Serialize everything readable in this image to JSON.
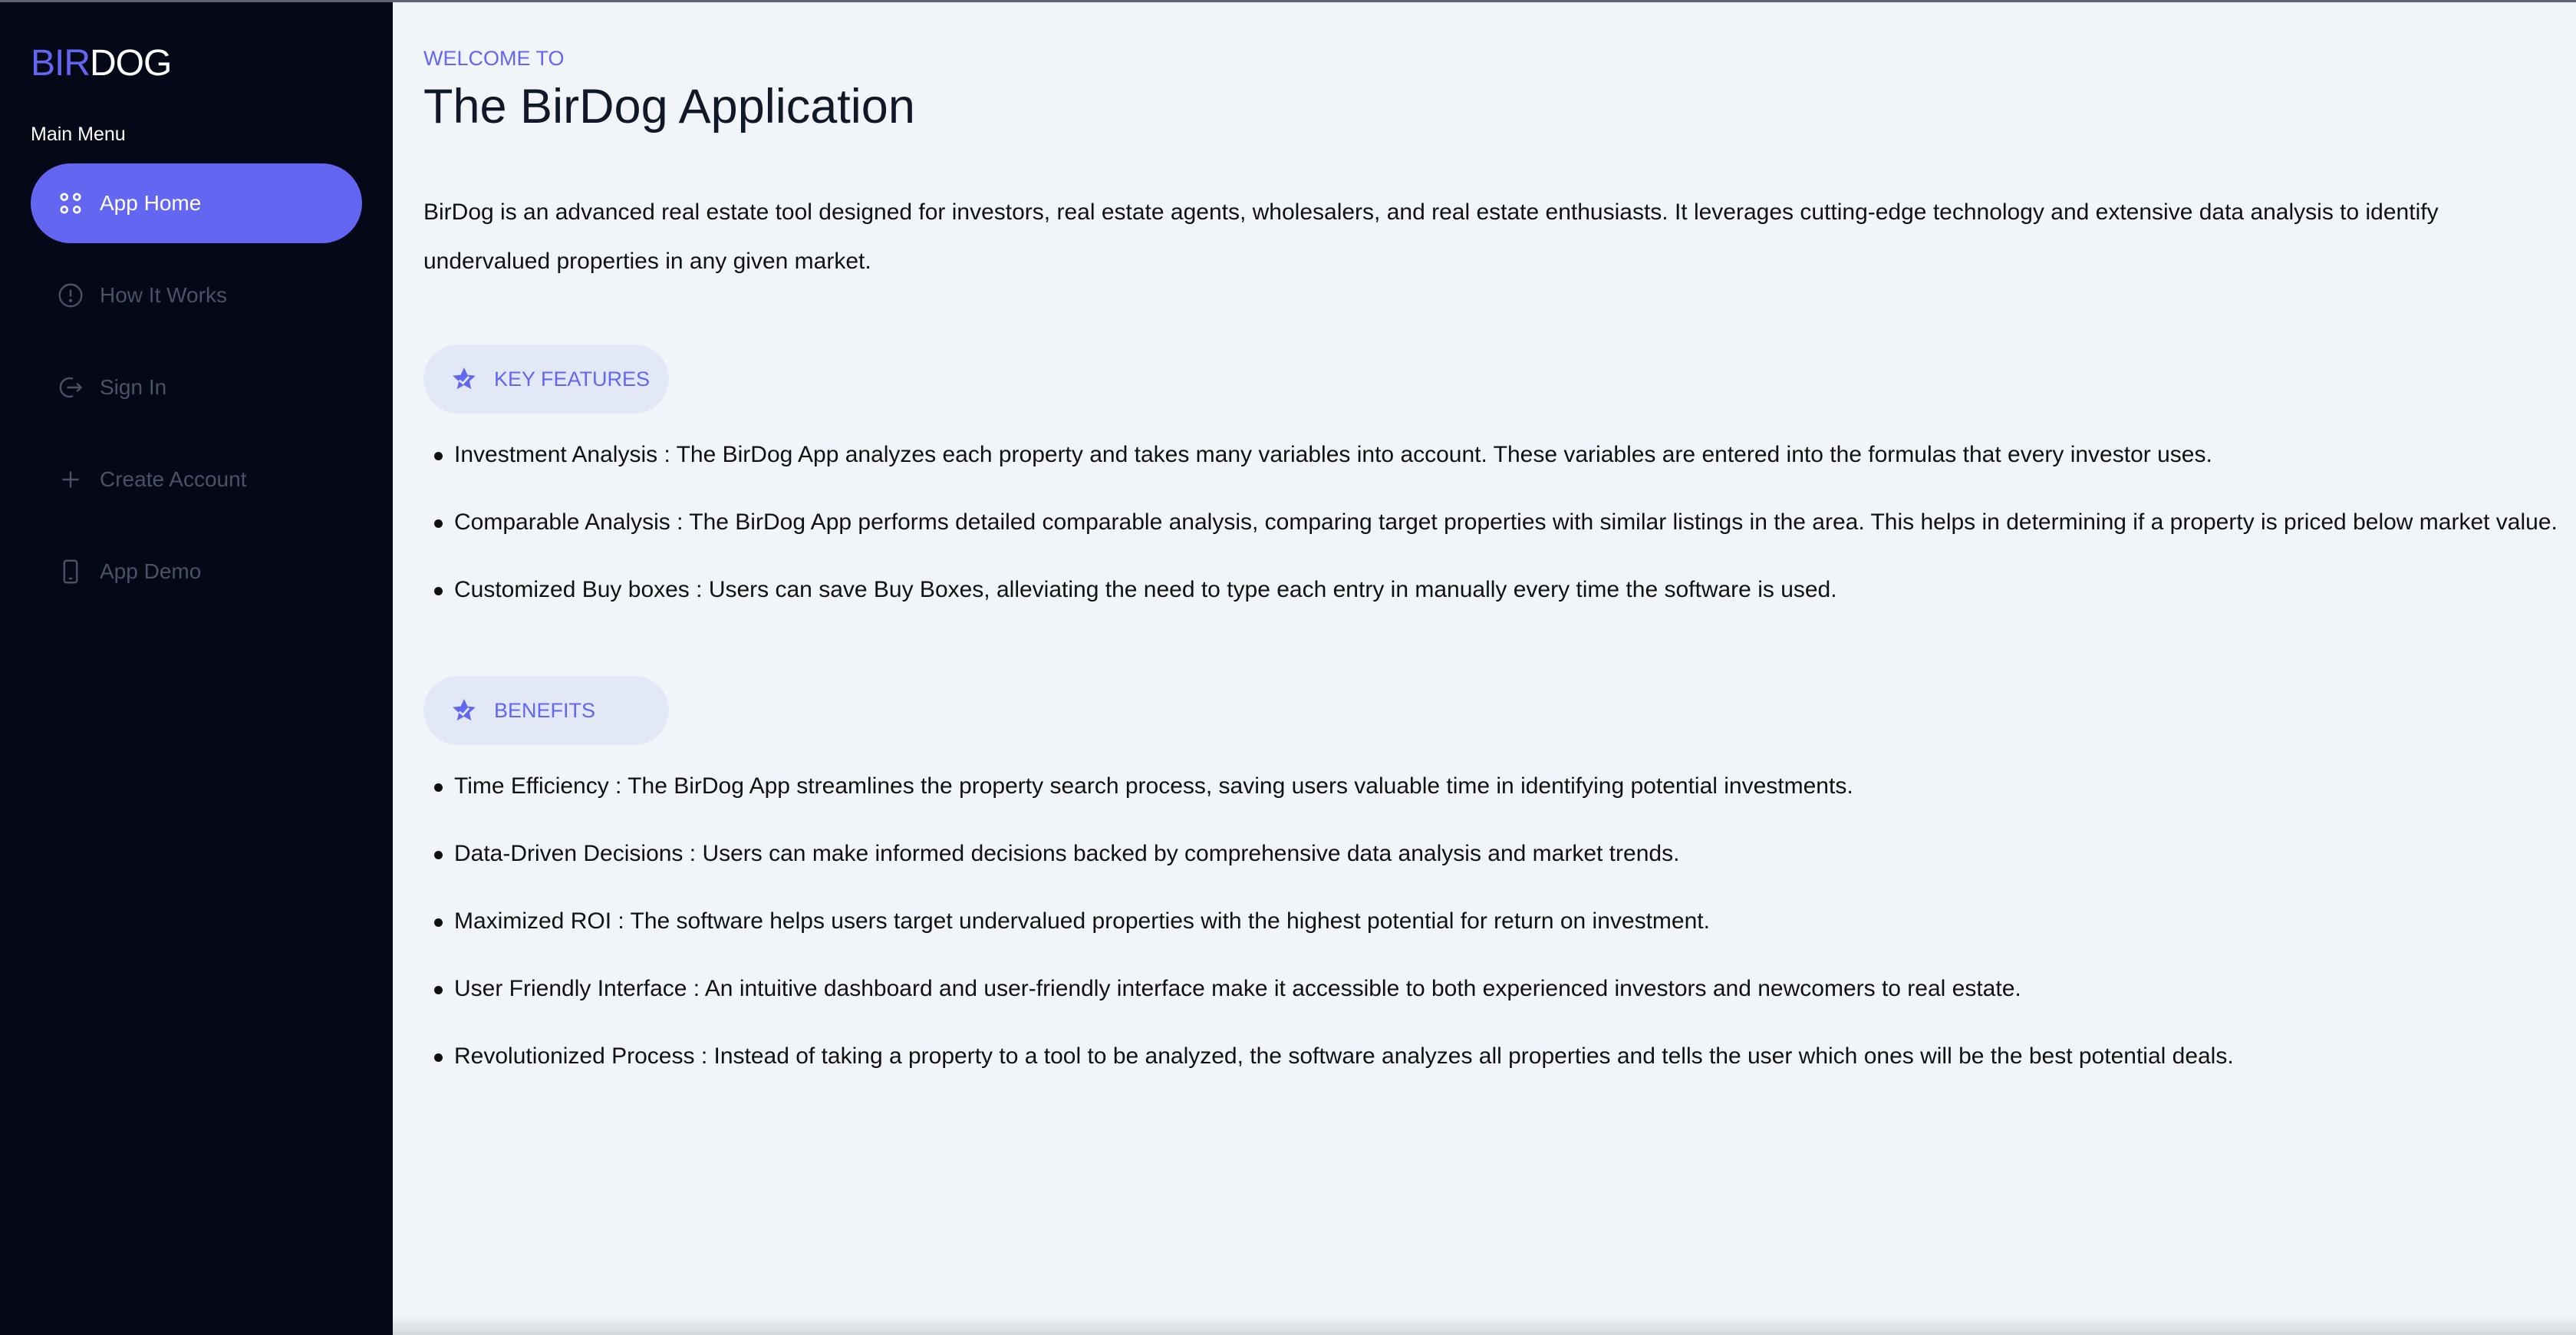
{
  "logo": {
    "part1": "BIR",
    "part2": "DOG"
  },
  "sidebar": {
    "menu_title": "Main Menu",
    "items": [
      {
        "label": "App Home",
        "icon": "grid-icon",
        "active": true
      },
      {
        "label": "How It Works",
        "icon": "info-circle-icon",
        "active": false
      },
      {
        "label": "Sign In",
        "icon": "sign-in-icon",
        "active": false
      },
      {
        "label": "Create Account",
        "icon": "plus-icon",
        "active": false
      },
      {
        "label": "App Demo",
        "icon": "phone-icon",
        "active": false
      }
    ]
  },
  "main": {
    "welcome": "WELCOME TO",
    "title": "The BirDog Application",
    "intro": "BirDog is an advanced real estate tool designed for investors, real estate agents, wholesalers, and real estate enthusiasts. It leverages cutting-edge technology and extensive data analysis to identify undervalued properties in any given market.",
    "features_label": "KEY FEATURES",
    "features": [
      "Investment Analysis : The BirDog App analyzes each property and takes many variables into account. These variables are entered into the formulas that every investor uses.",
      "Comparable Analysis : The BirDog App performs detailed comparable analysis, comparing target properties with similar listings in the area. This helps in determining if a property is priced below market value.",
      "Customized Buy boxes : Users can save Buy Boxes, alleviating the need to type each entry in manually every time the software is used."
    ],
    "benefits_label": "BENEFITS",
    "benefits": [
      "Time Efficiency : The BirDog App streamlines the property search process, saving users valuable time in identifying potential investments.",
      "Data-Driven Decisions : Users can make informed decisions backed by comprehensive data analysis and market trends.",
      "Maximized ROI : The software helps users target undervalued properties with the highest potential for return on investment.",
      "User Friendly Interface : An intuitive dashboard and user-friendly interface make it accessible to both experienced investors and newcomers to real estate.",
      "Revolutionized Process : Instead of taking a property to a tool to be analyzed, the software analyzes all properties and tells the user which ones will be the best potential deals."
    ]
  },
  "colors": {
    "accent": "#6366f1",
    "sidebar_bg": "#050816",
    "main_bg": "#f1f5f9",
    "pill_bg": "#e3e8f7"
  }
}
